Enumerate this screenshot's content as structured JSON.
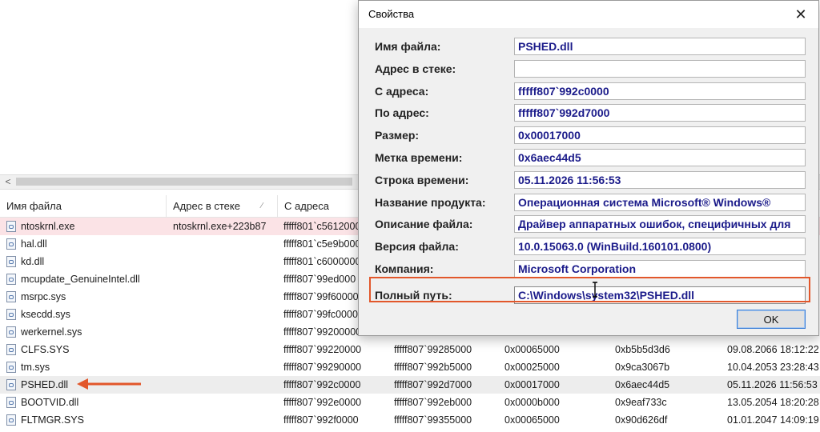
{
  "background": {
    "columns": [
      "Имя файла",
      "Адрес в стеке",
      "С адреса"
    ],
    "rows": [
      {
        "file": "ntoskrnl.exe",
        "stack": "ntoskrnl.exe+223b87",
        "from": "fffff801`c5612000",
        "to": "",
        "size": "",
        "timestamp": "",
        "datetime": "",
        "style": "highlight"
      },
      {
        "file": "hal.dll",
        "stack": "",
        "from": "fffff801`c5e9b000",
        "to": "",
        "size": "",
        "timestamp": "",
        "datetime": ""
      },
      {
        "file": "kd.dll",
        "stack": "",
        "from": "fffff801`c6000000",
        "to": "",
        "size": "",
        "timestamp": "",
        "datetime": ""
      },
      {
        "file": "mcupdate_GenuineIntel.dll",
        "stack": "",
        "from": "fffff807`99ed000",
        "to": "",
        "size": "",
        "timestamp": "",
        "datetime": ""
      },
      {
        "file": "msrpc.sys",
        "stack": "",
        "from": "fffff807`99f60000",
        "to": "",
        "size": "",
        "timestamp": "",
        "datetime": ""
      },
      {
        "file": "ksecdd.sys",
        "stack": "",
        "from": "fffff807`99fc0000",
        "to": "",
        "size": "",
        "timestamp": "",
        "datetime": ""
      },
      {
        "file": "werkernel.sys",
        "stack": "",
        "from": "fffff807`99200000",
        "to": "",
        "size": "",
        "timestamp": "",
        "datetime": ""
      },
      {
        "file": "CLFS.SYS",
        "stack": "",
        "from": "fffff807`99220000",
        "to": "fffff807`99285000",
        "size": "0x00065000",
        "timestamp": "0xb5b5d3d6",
        "datetime": "09.08.2066 18:12:22"
      },
      {
        "file": "tm.sys",
        "stack": "",
        "from": "fffff807`99290000",
        "to": "fffff807`992b5000",
        "size": "0x00025000",
        "timestamp": "0x9ca3067b",
        "datetime": "10.04.2053 23:28:43"
      },
      {
        "file": "PSHED.dll",
        "stack": "",
        "from": "fffff807`992c0000",
        "to": "fffff807`992d7000",
        "size": "0x00017000",
        "timestamp": "0x6aec44d5",
        "datetime": "05.11.2026 11:56:53",
        "style": "selected"
      },
      {
        "file": "BOOTVID.dll",
        "stack": "",
        "from": "fffff807`992e0000",
        "to": "fffff807`992eb000",
        "size": "0x0000b000",
        "timestamp": "0x9eaf733c",
        "datetime": "13.05.2054 18:20:28"
      },
      {
        "file": "FLTMGR.SYS",
        "stack": "",
        "from": "fffff807`992f0000",
        "to": "fffff807`99355000",
        "size": "0x00065000",
        "timestamp": "0x90d626df",
        "datetime": "01.01.2047 14:09:19"
      }
    ]
  },
  "dialog": {
    "title": "Свойства",
    "close_glyph": "✕",
    "fields": [
      {
        "label": "Имя файла:",
        "value": "PSHED.dll"
      },
      {
        "label": "Адрес в стеке:",
        "value": ""
      },
      {
        "label": "С адреса:",
        "value": "fffff807`992c0000"
      },
      {
        "label": "По адрес:",
        "value": "fffff807`992d7000"
      },
      {
        "label": "Размер:",
        "value": "0x00017000"
      },
      {
        "label": "Метка времени:",
        "value": "0x6aec44d5"
      },
      {
        "label": "Строка времени:",
        "value": "05.11.2026 11:56:53"
      },
      {
        "label": "Название продукта:",
        "value": "Операционная система Microsoft® Windows®"
      },
      {
        "label": "Описание файла:",
        "value": "Драйвер аппаратных ошибок, специфичных для"
      },
      {
        "label": "Версия файла:",
        "value": "10.0.15063.0 (WinBuild.160101.0800)"
      },
      {
        "label": "Компания:",
        "value": "Microsoft Corporation"
      },
      {
        "label": "Полный путь:",
        "value": "C:\\Windows\\system32\\PSHED.dll"
      }
    ],
    "ok_label": "OK"
  },
  "colors": {
    "value_text": "#1b1b8a",
    "annotation": "#e2572b",
    "row_highlight": "#fbe3e6",
    "row_selected": "#ededed"
  }
}
